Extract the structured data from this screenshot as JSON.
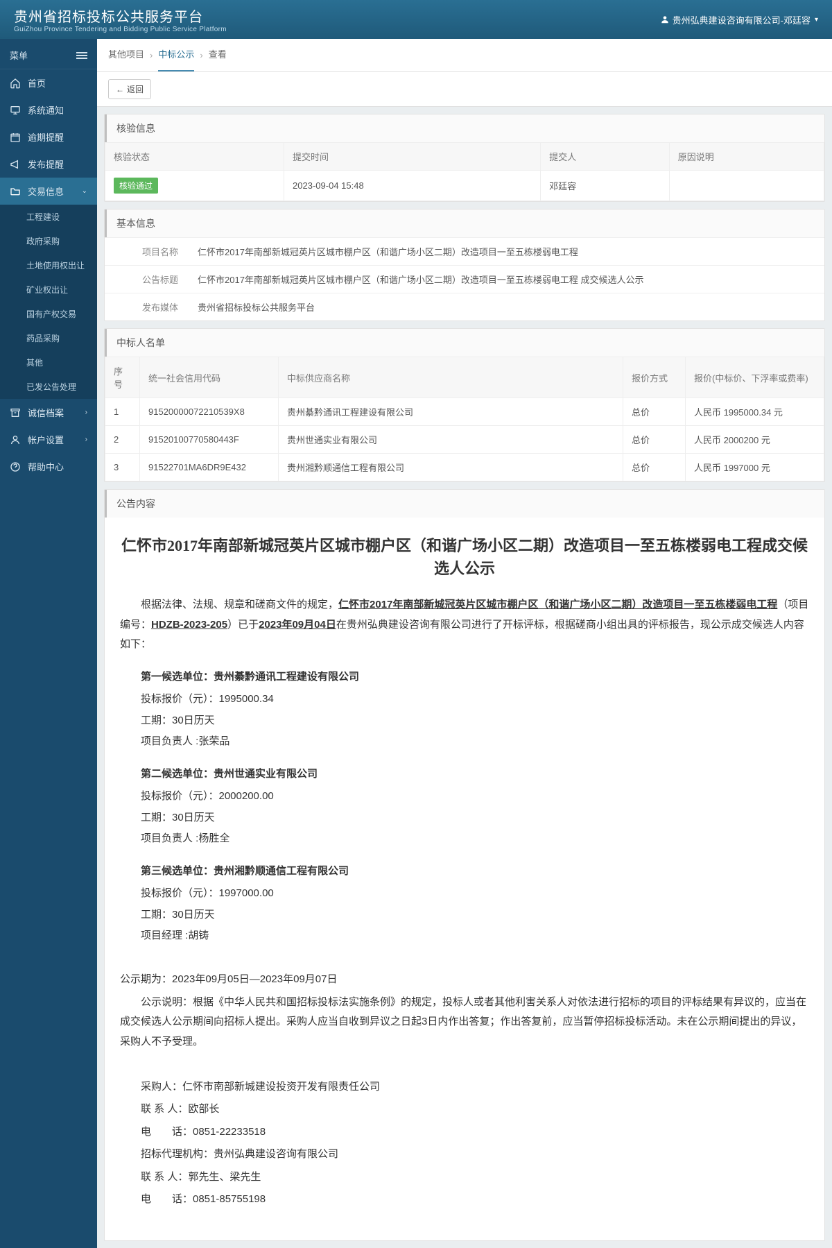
{
  "header": {
    "title": "贵州省招标投标公共服务平台",
    "subtitle": "GuiZhou Province Tendering and Bidding Public Service Platform",
    "user": "贵州弘典建设咨询有限公司-邓廷容"
  },
  "sidebar": {
    "menu_label": "菜单",
    "items": {
      "home": "首页",
      "notice": "系统通知",
      "overdue": "逾期提醒",
      "publish": "发布提醒",
      "trade": "交易信息",
      "credit": "诚信档案",
      "account": "帐户设置",
      "help": "帮助中心"
    },
    "trade_subs": {
      "engineering": "工程建设",
      "gov": "政府采购",
      "land": "土地使用权出让",
      "mining": "矿业权出让",
      "stateasset": "国有产权交易",
      "medicine": "药品采购",
      "other": "其他",
      "published": "已发公告处理"
    }
  },
  "breadcrumb": {
    "a": "其他项目",
    "b": "中标公示",
    "c": "查看"
  },
  "toolbar": {
    "back": "返回"
  },
  "verify": {
    "title": "核验信息",
    "cols": {
      "status": "核验状态",
      "time": "提交时间",
      "person": "提交人",
      "reason": "原因说明"
    },
    "row": {
      "status": "核验通过",
      "time": "2023-09-04 15:48",
      "person": "邓廷容",
      "reason": ""
    }
  },
  "basic": {
    "title": "基本信息",
    "rows": {
      "name_lbl": "项目名称",
      "name_val": "仁怀市2017年南部新城冠英片区城市棚户区（和谐广场小区二期）改造项目一至五栋楼弱电工程",
      "notice_lbl": "公告标题",
      "notice_val": "仁怀市2017年南部新城冠英片区城市棚户区（和谐广场小区二期）改造项目一至五栋楼弱电工程 成交候选人公示",
      "media_lbl": "发布媒体",
      "media_val": "贵州省招标投标公共服务平台"
    }
  },
  "winners": {
    "title": "中标人名单",
    "cols": {
      "idx": "序号",
      "code": "统一社会信用代码",
      "supplier": "中标供应商名称",
      "mode": "报价方式",
      "price": "报价(中标价、下浮率或费率)"
    },
    "rows": [
      {
        "idx": "1",
        "code": "91520000072210539X8",
        "supplier": "贵州綦黔通讯工程建设有限公司",
        "mode": "总价",
        "price": "人民币 1995000.34 元"
      },
      {
        "idx": "2",
        "code": "91520100770580443F",
        "supplier": "贵州世通实业有限公司",
        "mode": "总价",
        "price": "人民币 2000200 元"
      },
      {
        "idx": "3",
        "code": "91522701MA6DR9E432",
        "supplier": "贵州湘黔顺通信工程有限公司",
        "mode": "总价",
        "price": "人民币 1997000 元"
      }
    ]
  },
  "announce": {
    "title": "公告内容",
    "big_title": "仁怀市2017年南部新城冠英片区城市棚户区（和谐广场小区二期）改造项目一至五栋楼弱电工程成交候选人公示",
    "intro_pre": "根据法律、法规、规章和磋商文件的规定，",
    "intro_proj": "仁怀市2017年南部新城冠英片区城市棚户区（和谐广场小区二期）改造项目一至五栋楼弱电工程",
    "intro_mid1": "（项目编号：",
    "intro_code": "HDZB-2023-205",
    "intro_mid2": "）已于",
    "intro_date": "2023年09月04日",
    "intro_post": "在贵州弘典建设咨询有限公司进行了开标评标，根据磋商小组出具的评标报告，现公示成交候选人内容如下：",
    "cands": [
      {
        "head": "第一候选单位：贵州綦黔通讯工程建设有限公司",
        "price": "投标报价（元）：1995000.34",
        "period": "工期：30日历天",
        "leader": "项目负责人 :张荣品"
      },
      {
        "head": "第二候选单位：贵州世通实业有限公司",
        "price": "投标报价（元）：2000200.00",
        "period": "工期：30日历天",
        "leader": "项目负责人 :杨胜全"
      },
      {
        "head": "第三候选单位：贵州湘黔顺通信工程有限公司",
        "price": "投标报价（元）：1997000.00",
        "period": "工期：30日历天",
        "leader": "项目经理 :胡铸"
      }
    ],
    "period_line": "公示期为：2023年09月05日—2023年09月07日",
    "note": "公示说明：根据《中华人民共和国招标投标法实施条例》的规定，投标人或者其他利害关系人对依法进行招标的项目的评标结果有异议的，应当在成交候选人公示期间向招标人提出。采购人应当自收到异议之日起3日内作出答复；作出答复前，应当暂停招标投标活动。未在公示期间提出的异议，采购人不予受理。",
    "buyer": "采购人：仁怀市南部新城建设投资开发有限责任公司",
    "buyer_contact": "联 系 人：欧部长",
    "buyer_phone": "电　　话：0851-22233518",
    "agent": "招标代理机构：贵州弘典建设咨询有限公司",
    "agent_contact": "联 系 人：郭先生、梁先生",
    "agent_phone": "电　　话：0851-85755198"
  }
}
